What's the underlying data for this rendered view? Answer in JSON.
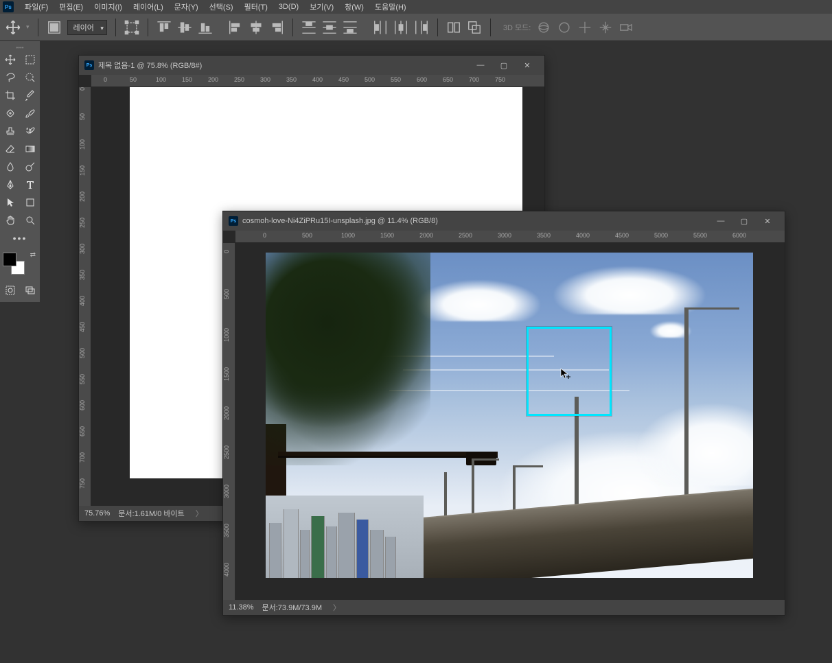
{
  "menu": {
    "items": [
      "파일(F)",
      "편집(E)",
      "이미지(I)",
      "레이어(L)",
      "문자(Y)",
      "선택(S)",
      "필터(T)",
      "3D(D)",
      "보기(V)",
      "창(W)",
      "도움말(H)"
    ]
  },
  "options": {
    "layer_label": "레이어",
    "mode3d_label": "3D 모드:"
  },
  "doc1": {
    "title": "제목 없음-1 @ 75.8% (RGB/8#)",
    "zoom": "75.76%",
    "status_prefix": "문서:",
    "status_value": "1.61M/0 바이트",
    "ruler_h": [
      "0",
      "50",
      "100",
      "150",
      "200",
      "250",
      "300",
      "350",
      "400",
      "450",
      "500",
      "550",
      "600",
      "650",
      "700",
      "750"
    ],
    "ruler_v": [
      "0",
      "50",
      "100",
      "150",
      "200",
      "250",
      "300",
      "350",
      "400",
      "450",
      "500",
      "550",
      "600",
      "650",
      "700",
      "750"
    ]
  },
  "doc2": {
    "title": "cosmoh-love-Ni4ZiPRu15I-unsplash.jpg @ 11.4% (RGB/8)",
    "zoom": "11.38%",
    "status_prefix": "문서:",
    "status_value": "73.9M/73.9M",
    "ruler_h": [
      "0",
      "500",
      "1000",
      "1500",
      "2000",
      "2500",
      "3000",
      "3500",
      "4000",
      "4500",
      "5000",
      "5500",
      "6000"
    ],
    "ruler_v": [
      "0",
      "500",
      "1000",
      "1500",
      "2000",
      "2500",
      "3000",
      "3500",
      "4000"
    ]
  }
}
